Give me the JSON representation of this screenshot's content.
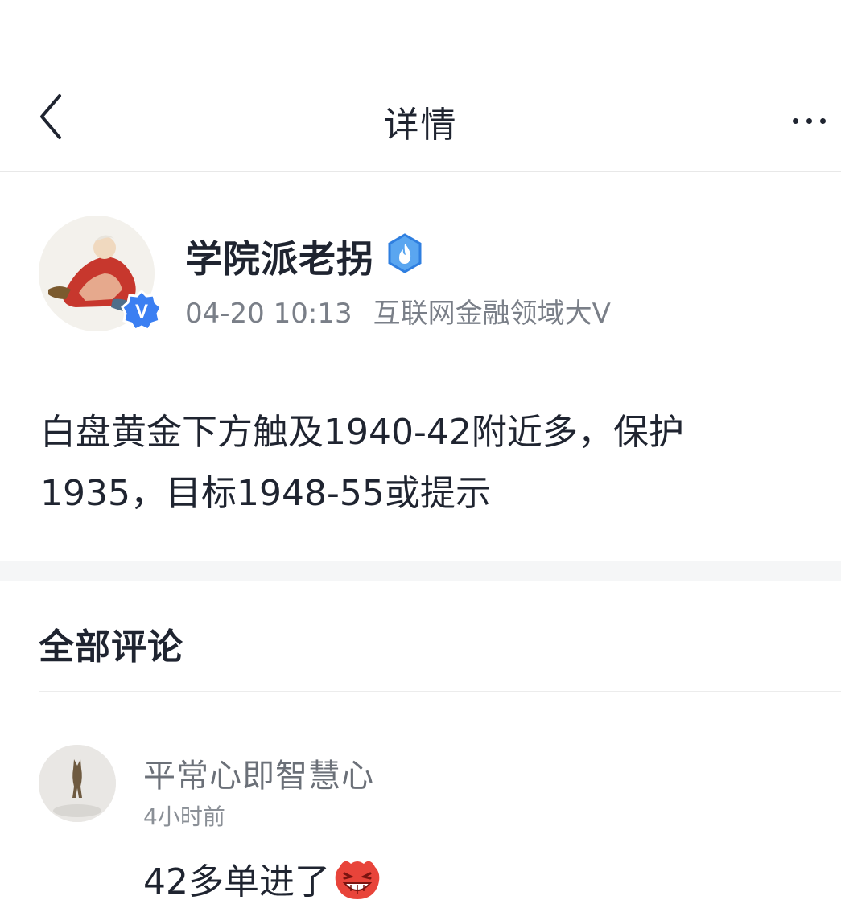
{
  "nav": {
    "title": "详情",
    "back_icon": "chevron-left-icon",
    "more_icon": "more-horizontal-icon"
  },
  "post": {
    "author_name": "学院派老拐",
    "time": "04-20 10:13",
    "tag": "互联网金融领域大V",
    "body": "白盘黄金下方触及1940-42附近多，保护1935，目标1948-55或提示",
    "verified_letter": "V"
  },
  "comments": {
    "heading": "全部评论",
    "items": [
      {
        "user": "平常心即智慧心",
        "time": "4小时前",
        "text": "42多单进了",
        "emoji": "laughing-face-emoji"
      }
    ]
  },
  "colors": {
    "text": "#1f2430",
    "meta": "#7a7f88",
    "badge_blue": "#3b7ff2",
    "band": "#f5f6f7",
    "emoji_red": "#e8443a"
  }
}
